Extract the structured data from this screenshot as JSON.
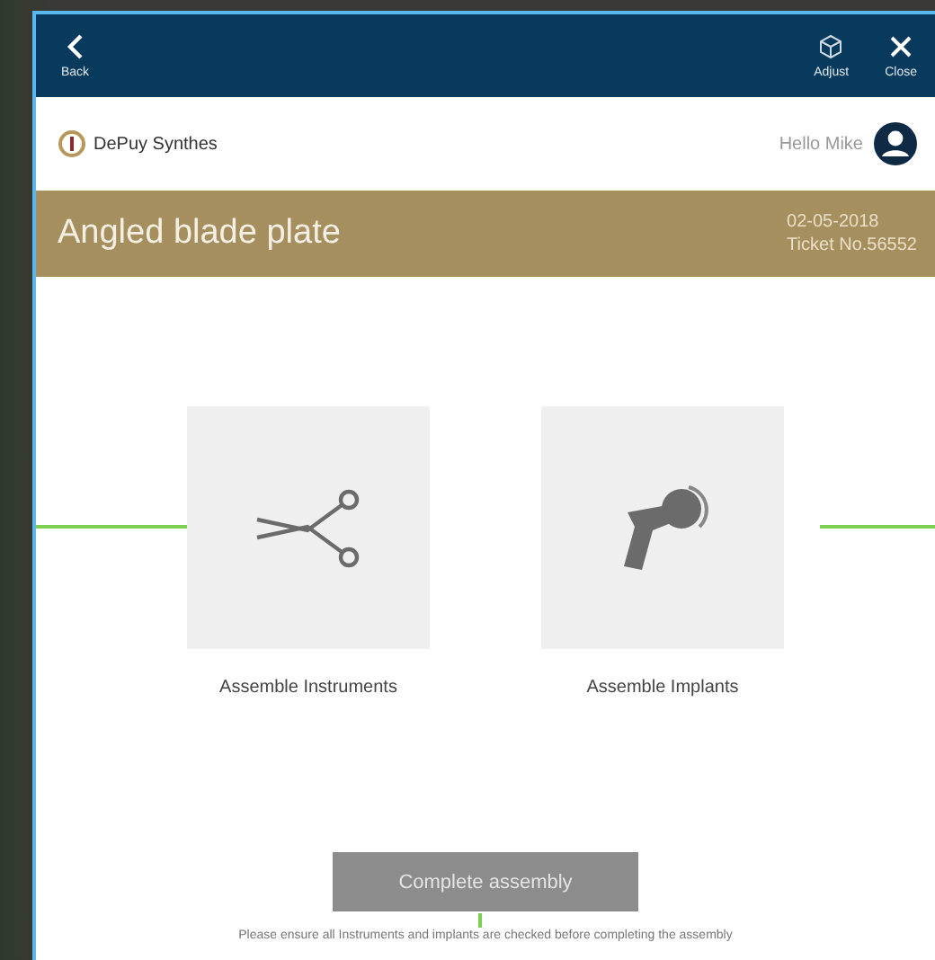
{
  "toolbar": {
    "back": "Back",
    "actions": [
      {
        "kind": "adjust",
        "label": "Adjust"
      },
      {
        "kind": "close",
        "label": "Close"
      }
    ]
  },
  "brand": {
    "name": "DePuy Synthes"
  },
  "user": {
    "greeting": "Hello Mike"
  },
  "banner": {
    "title": "Angled blade plate",
    "date": "02-05-2018",
    "ticket": "Ticket No.56552"
  },
  "steps": [
    {
      "kind": "instruments",
      "label": "Assemble Instruments"
    },
    {
      "kind": "implants",
      "label": "Assemble Implants"
    }
  ],
  "complete_button": {
    "label": "Complete assembly",
    "disabled": true
  },
  "note": "Please ensure all Instruments and implants are checked before completing the assembly"
}
